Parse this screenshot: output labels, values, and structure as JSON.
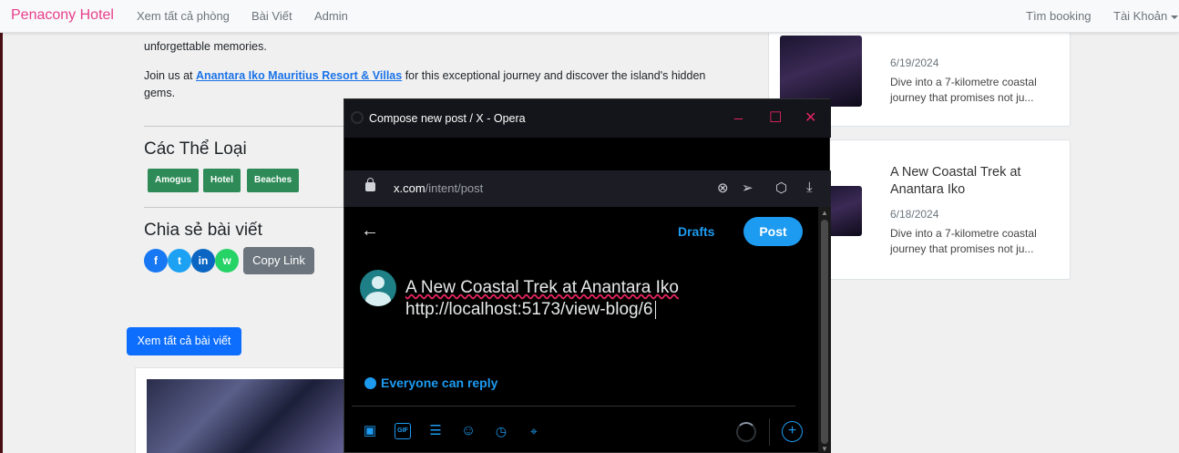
{
  "navbar": {
    "brand": "Penacony Hotel",
    "links": [
      "Xem tất cả phòng",
      "Bài Viết",
      "Admin"
    ],
    "right_links": [
      "Tìm booking",
      "Tài Khoản"
    ],
    "brand_color": "#e83e8c"
  },
  "article": {
    "paragraph_tail": "unforgettable memories.",
    "join_prefix": "Join us at ",
    "join_link": "Anantara Iko Mauritius Resort & Villas",
    "join_suffix": " for this exceptional journey and discover the island's hidden gems.",
    "categories_title": "Các Thể Loại",
    "tags": [
      "Amogus",
      "Hotel",
      "Beaches"
    ],
    "share_title": "Chia sẻ bài viết",
    "share_icons": [
      "facebook-icon",
      "twitter-icon",
      "linkedin-icon",
      "whatsapp-icon"
    ],
    "share_glyphs": [
      "f",
      "t",
      "in",
      "w"
    ],
    "copy_link": "Copy Link",
    "all_posts": "Xem tất cả bài viết"
  },
  "sidebar": {
    "cards": [
      {
        "title": "",
        "date": "6/19/2024",
        "desc": "Dive into a 7-kilometre coastal journey that promises not ju..."
      },
      {
        "title": "A New Coastal Trek at Anantara Iko",
        "date": "6/18/2024",
        "desc": "Dive into a 7-kilometre coastal journey that promises not ju..."
      }
    ]
  },
  "popup": {
    "window_title": "Compose new post / X - Opera",
    "url_host": "x.com",
    "url_path": "/intent/post",
    "drafts": "Drafts",
    "post": "Post",
    "compose_line1": "A New Coastal Trek at Anantara Iko",
    "compose_line2": "http://localhost:5173/view-blog/6",
    "reply_setting": "Everyone can reply",
    "tool_gif": "GIF",
    "accent": "#1d9bf0"
  }
}
